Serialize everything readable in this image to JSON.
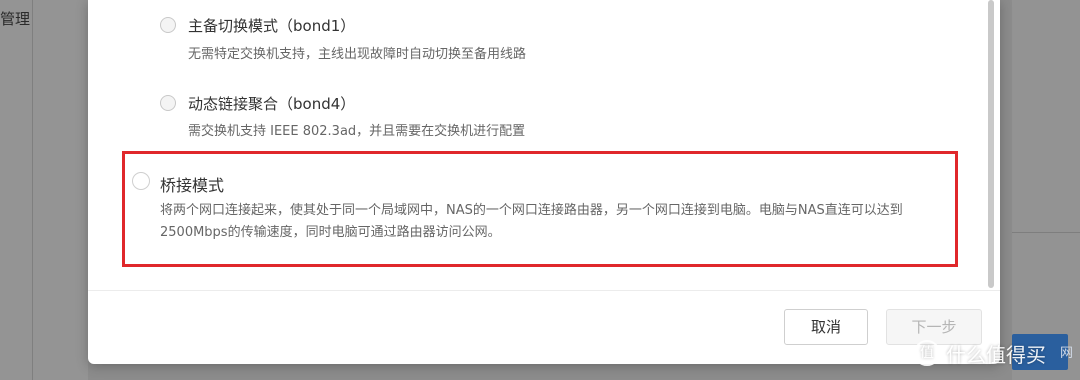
{
  "background": {
    "left_label": "管理",
    "right_button_text": "网"
  },
  "dialog": {
    "options": [
      {
        "title": "主备切换模式（bond1）",
        "description": "无需特定交换机支持，主线出现故障时自动切换至备用线路"
      },
      {
        "title": "动态链接聚合（bond4）",
        "description": "需交换机支持 IEEE 802.3ad，并且需要在交换机进行配置"
      },
      {
        "title": "桥接模式",
        "description": "将两个网口连接起来，使其处于同一个局域网中，NAS的一个网口连接路由器，另一个网口连接到电脑。电脑与NAS直连可以达到2500Mbps的传输速度，同时电脑可通过路由器访问公网。"
      }
    ],
    "highlight_color": "#e0282b",
    "buttons": {
      "cancel": "取消",
      "next": "下一步"
    }
  },
  "watermark": {
    "icon": "值",
    "text": "什么值得买"
  }
}
